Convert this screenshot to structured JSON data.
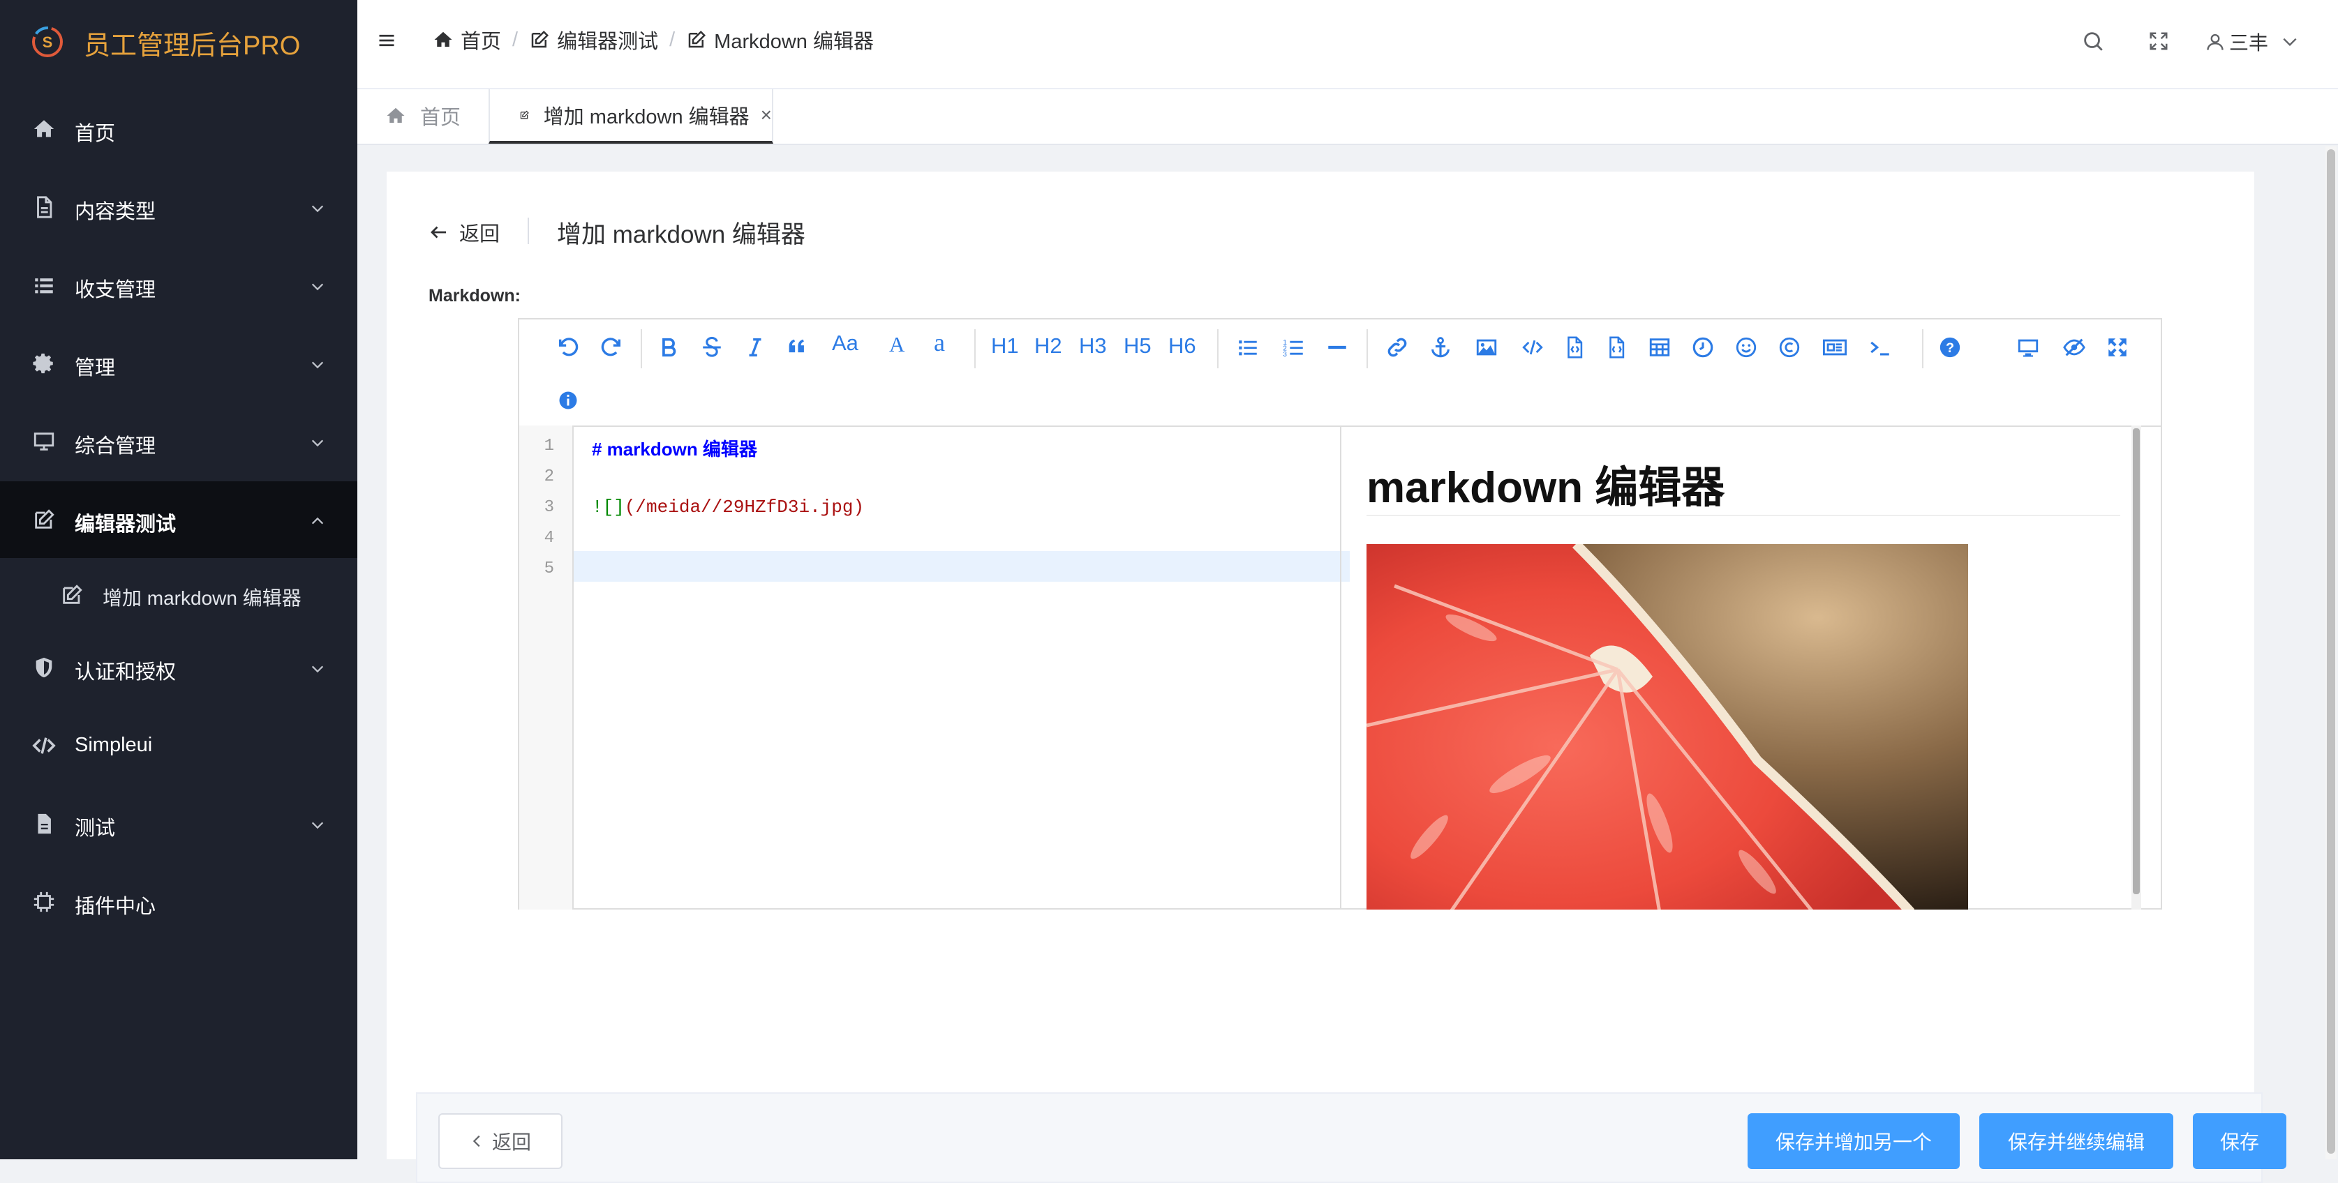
{
  "app": {
    "title": "员工管理后台PRO"
  },
  "sidebar": {
    "items": [
      {
        "label": "首页",
        "icon": "home-icon"
      },
      {
        "label": "内容类型",
        "icon": "file-icon"
      },
      {
        "label": "收支管理",
        "icon": "list-icon"
      },
      {
        "label": "管理",
        "icon": "gear-icon"
      },
      {
        "label": "综合管理",
        "icon": "monitor-icon"
      },
      {
        "label": "编辑器测试",
        "icon": "edit-icon"
      },
      {
        "label": "增加 markdown 编辑器",
        "icon": "edit-icon"
      },
      {
        "label": "认证和授权",
        "icon": "shield-icon"
      },
      {
        "label": "Simpleui",
        "icon": "code-icon"
      },
      {
        "label": "测试",
        "icon": "file-icon"
      },
      {
        "label": "插件中心",
        "icon": "chip-icon"
      }
    ]
  },
  "breadcrumb": {
    "home": "首页",
    "level1": "编辑器测试",
    "level2": "Markdown 编辑器",
    "separator": "/"
  },
  "header": {
    "user": "三丰"
  },
  "tabs": {
    "home": "首页",
    "active": "增加 markdown 编辑器",
    "close": "×"
  },
  "page": {
    "back": "返回",
    "title": "增加 markdown 编辑器",
    "field_label": "Markdown:"
  },
  "toolbar": {
    "headings": [
      "H1",
      "H2",
      "H3",
      "H5",
      "H6"
    ],
    "text_buttons": [
      "Aa",
      "A",
      "a"
    ]
  },
  "editor": {
    "line_numbers": [
      "1",
      "2",
      "3",
      "4",
      "5"
    ],
    "line1": "# markdown 编辑器",
    "line3_bang": "!",
    "line3_brackets": "[]",
    "line3_url": "(/meida//29HZfD3i.jpg)",
    "colors": {
      "heading": "#0000ff",
      "link": "#a11",
      "bracket": "#008800",
      "toolbar": "#2c7be5"
    }
  },
  "preview": {
    "heading": "markdown 编辑器"
  },
  "footer": {
    "back": "返回",
    "save_add_another": "保存并增加另一个",
    "save_continue": "保存并继续编辑",
    "save": "保存"
  },
  "colors": {
    "sidebar_bg": "#1e222d",
    "logo_text": "#e6a23c",
    "primary": "#409eff"
  }
}
